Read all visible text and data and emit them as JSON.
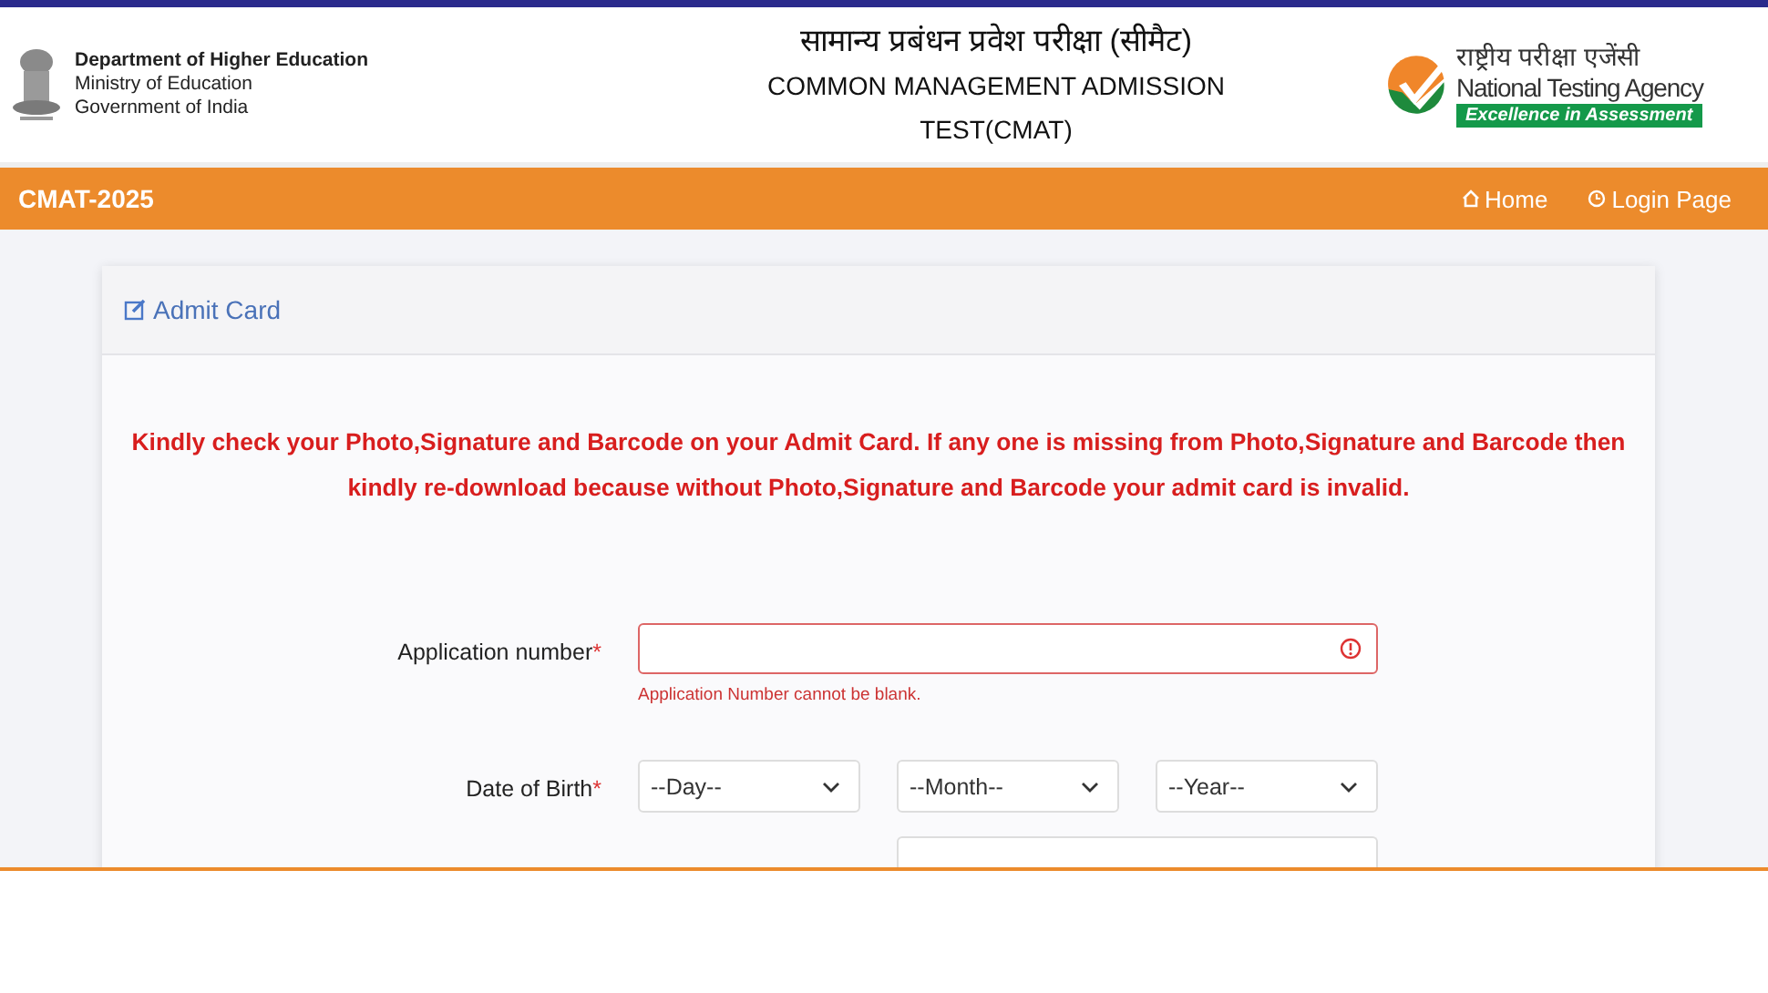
{
  "header": {
    "department": "Department of Higher Education",
    "ministry": "Ministry of Education",
    "government": "Government of India",
    "title_hindi": "सामान्य प्रबंधन प्रवेश परीक्षा (सीमैट)",
    "title_line_1": "COMMON MANAGEMENT ADMISSION",
    "title_line_2": "TEST(CMAT)",
    "agency_hindi": "राष्ट्रीय परीक्षा एजेंसी",
    "agency_name": "National Testing Agency",
    "agency_tagline": "Excellence in Assessment"
  },
  "navbar": {
    "brand": "CMAT-2025",
    "links": [
      {
        "label": "Home",
        "kind": "home"
      },
      {
        "label": "Login Page",
        "kind": "login"
      }
    ]
  },
  "card": {
    "title": "Admit Card",
    "notice": "Kindly check your Photo,Signature and Barcode on your Admit Card. If any one is missing from Photo,Signature and Barcode then kindly re-download because without Photo,Signature and Barcode your admit card is invalid.",
    "application": {
      "label": "Application number",
      "required": "*",
      "error": "Application Number cannot be blank.",
      "invalid": true
    },
    "dob": {
      "label": "Date of Birth",
      "required": "*",
      "selects": [
        "--Day--",
        "--Month--",
        "--Year--"
      ]
    }
  }
}
